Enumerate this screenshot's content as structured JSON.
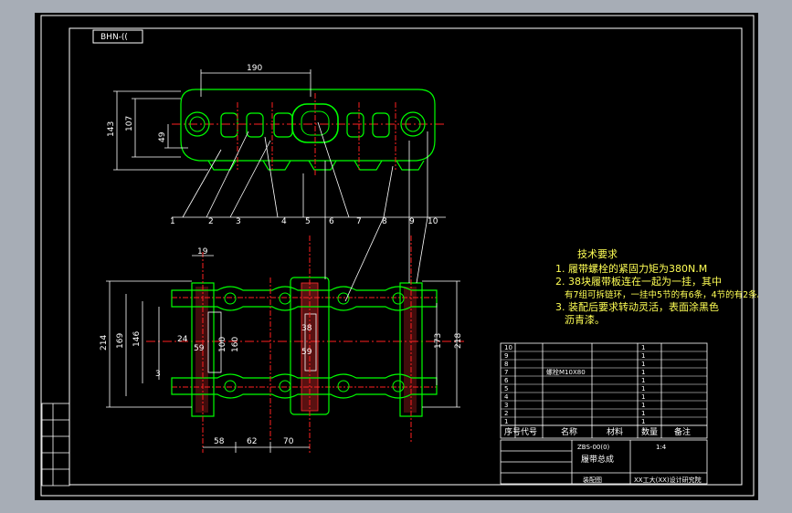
{
  "drawing": {
    "stamp": "BHN-((",
    "colors": {
      "background": "#000000",
      "frame": "#ffffff",
      "part": "#00ff00",
      "centerline": "#ff2020",
      "section_hatch": "#ff3030",
      "dimension": "#ffffff",
      "note": "#ffff55",
      "table_text": "#ffffff",
      "table_border": "#ffffff"
    }
  },
  "top_view": {
    "dimensions": {
      "pitch": "190",
      "height": "143",
      "inner_height": "107",
      "lug": "49"
    },
    "balloons": [
      "1",
      "2",
      "3",
      "4",
      "5",
      "6",
      "7",
      "8",
      "9",
      "10"
    ]
  },
  "bottom_view": {
    "dimensions": {
      "top_small": "19",
      "width_overall": "214",
      "w169": "169",
      "w146": "146",
      "w100": "100",
      "w160": "160",
      "w24": "24",
      "w59a": "59",
      "w38": "38",
      "w59b": "59",
      "w173": "173",
      "w218": "218",
      "w3": "3",
      "d58": "58",
      "d62": "62",
      "d70": "70"
    }
  },
  "technical_notes": {
    "title": "技术要求",
    "lines": [
      "1. 履带螺栓的紧固力矩为380N.M",
      "2. 38块履带板连在一起为一挂，其中",
      "有7组可拆链环，一挂中5节的有6条，4节的有2条。",
      "3. 装配后要求转动灵活，表面涂黑色",
      "沥青漆。"
    ]
  },
  "parts_list": {
    "rows": [
      [
        "10",
        "",
        "",
        "",
        "1"
      ],
      [
        "9",
        "",
        "",
        "",
        "1"
      ],
      [
        "8",
        "",
        "",
        "",
        "1"
      ],
      [
        "7",
        "",
        "螺栓M10X80",
        "",
        "1"
      ],
      [
        "6",
        "",
        "",
        "",
        "1"
      ],
      [
        "5",
        "",
        "",
        "",
        "1"
      ],
      [
        "4",
        "",
        "",
        "",
        "1"
      ],
      [
        "3",
        "",
        "",
        "",
        "1"
      ],
      [
        "2",
        "",
        "",
        "",
        "1"
      ],
      [
        "1",
        "",
        "",
        "",
        "1"
      ]
    ],
    "header": [
      "序号",
      "代号",
      "名称",
      "材料",
      "数量",
      "备注"
    ]
  },
  "title_block": {
    "drawing_no": "ZBS-00(0)",
    "drawing_name": "履带总成",
    "scale": "1:4",
    "material_note": "",
    "school": "XX工大(XX)设计研究院",
    "assembly_label": "装配图"
  },
  "side_stamp": {
    "rows": [
      "",
      "",
      "",
      "",
      ""
    ]
  }
}
